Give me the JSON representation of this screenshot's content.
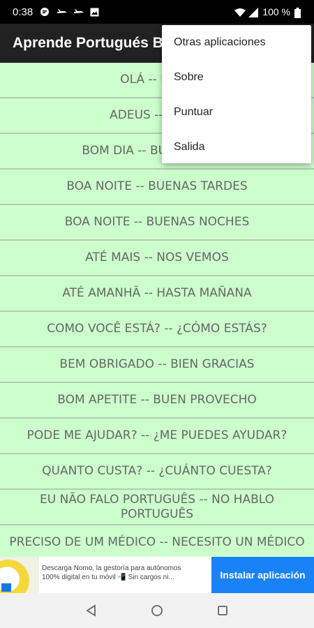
{
  "status_bar": {
    "time": "0:38",
    "battery_text": "100 %",
    "icons": [
      "chat-icon",
      "airplane-icon",
      "airplane-icon",
      "image-icon",
      "wifi-icon",
      "signal-icon",
      "battery-icon"
    ]
  },
  "app_bar": {
    "title": "Aprende Portugués Ba"
  },
  "menu": {
    "items": [
      "Otras aplicaciones",
      "Sobre",
      "Puntuar",
      "Salida"
    ]
  },
  "phrases": [
    "OLÁ -- HOLA",
    "ADEUS -- ADIÓS",
    "BOM DIA -- BUENOS DÍAS",
    "BOA NOITE -- BUENAS TARDES",
    "BOA NOITE -- BUENAS NOCHES",
    "ATÉ MAIS -- NOS VEMOS",
    "ATÉ AMANHÃ -- HASTA MAÑANA",
    "COMO VOCÊ ESTÁ? -- ¿CÓMO ESTÁS?",
    "BEM OBRIGADO -- BIEN GRACIAS",
    "BOM APETITE -- BUEN PROVECHO",
    "PODE ME AJUDAR? -- ¿ME PUEDES AYUDAR?",
    "QUANTO CUSTA? -- ¿CUÁNTO CUESTA?",
    "EU NÃO FALO PORTUGUÊS -- NO HABLO PORTUGUÊS",
    "PRECISO DE UM MÉDICO -- NECESITO UN MÉDICO"
  ],
  "ad": {
    "line1": "Descarga Nomo, la gestoría para autónomos",
    "line2": "100% digital en tu móvil 📲 Sin cargos ni...",
    "button_label": "Instalar aplicación"
  },
  "colors": {
    "list_background": "#ccffcc",
    "app_bar": "#212121",
    "ad_button": "#1a82f7"
  }
}
